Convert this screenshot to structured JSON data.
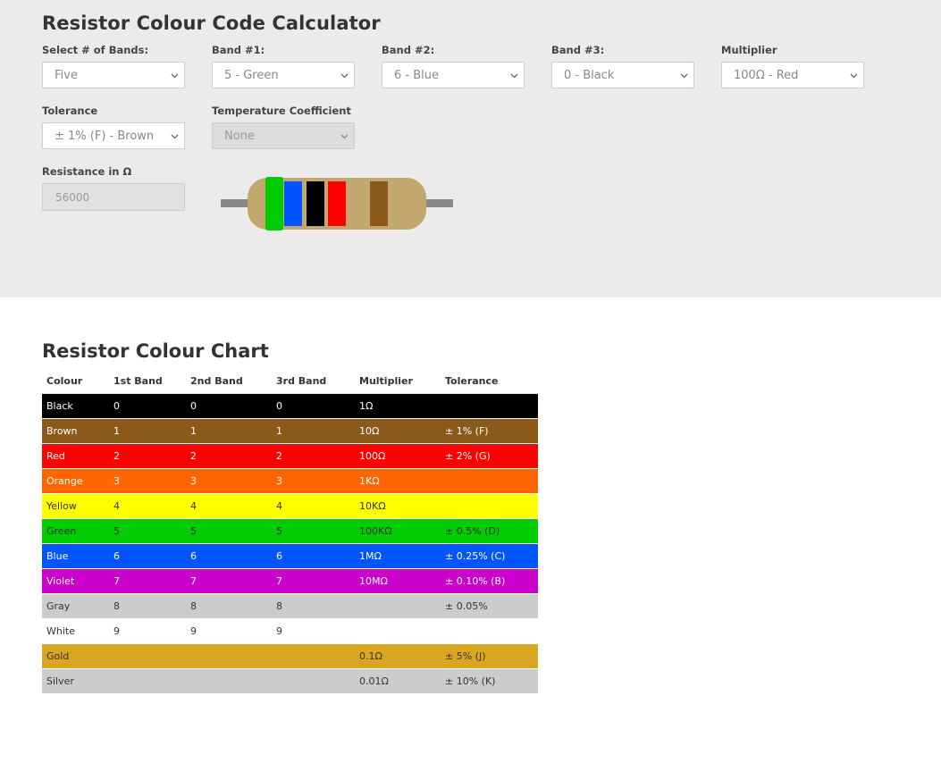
{
  "calculator": {
    "title": "Resistor Colour Code Calculator",
    "bands_label": "Select # of Bands:",
    "bands_value": "Five",
    "band1_label": "Band #1:",
    "band1_value": "5 - Green",
    "band2_label": "Band #2:",
    "band2_value": "6 - Blue",
    "band3_label": "Band #3:",
    "band3_value": "0 - Black",
    "multiplier_label": "Multiplier",
    "multiplier_value": "100Ω - Red",
    "tolerance_label": "Tolerance",
    "tolerance_value": "± 1% (F) - Brown",
    "tempco_label": "Temperature Coefficient",
    "tempco_value": "None",
    "resistance_label": "Resistance in Ω",
    "resistance_value": "56000"
  },
  "resistor_bands": [
    "#00cc00",
    "#0055ff",
    "#000000",
    "#ff0000",
    "#8b5a1a"
  ],
  "chart": {
    "title": "Resistor Colour Chart",
    "headers": [
      "Colour",
      "1st Band",
      "2nd Band",
      "3rd Band",
      "Multiplier",
      "Tolerance"
    ],
    "rows": [
      {
        "cells": [
          "Black",
          "0",
          "0",
          "0",
          "1Ω",
          ""
        ],
        "bg": "#000000",
        "fg": "#ffffff"
      },
      {
        "cells": [
          "Brown",
          "1",
          "1",
          "1",
          "10Ω",
          "± 1% (F)"
        ],
        "bg": "#8b5a1a",
        "fg": "#ffffff"
      },
      {
        "cells": [
          "Red",
          "2",
          "2",
          "2",
          "100Ω",
          "± 2% (G)"
        ],
        "bg": "#ff0000",
        "fg": "#ffffff"
      },
      {
        "cells": [
          "Orange",
          "3",
          "3",
          "3",
          "1KΩ",
          ""
        ],
        "bg": "#ff6600",
        "fg": "#ffffff"
      },
      {
        "cells": [
          "Yellow",
          "4",
          "4",
          "4",
          "10KΩ",
          ""
        ],
        "bg": "#ffff00",
        "fg": "#333333"
      },
      {
        "cells": [
          "Green",
          "5",
          "5",
          "5",
          "100KΩ",
          "± 0.5% (D)"
        ],
        "bg": "#00cc00",
        "fg": "#333333"
      },
      {
        "cells": [
          "Blue",
          "6",
          "6",
          "6",
          "1MΩ",
          "± 0.25% (C)"
        ],
        "bg": "#0055ff",
        "fg": "#ffffff"
      },
      {
        "cells": [
          "Violet",
          "7",
          "7",
          "7",
          "10MΩ",
          "± 0.10% (B)"
        ],
        "bg": "#cc00cc",
        "fg": "#ffffff"
      },
      {
        "cells": [
          "Gray",
          "8",
          "8",
          "8",
          "",
          "± 0.05%"
        ],
        "bg": "#cccccc",
        "fg": "#333333"
      },
      {
        "cells": [
          "White",
          "9",
          "9",
          "9",
          "",
          ""
        ],
        "bg": "#ffffff",
        "fg": "#333333"
      },
      {
        "cells": [
          "Gold",
          "",
          "",
          "",
          "0.1Ω",
          "± 5% (J)"
        ],
        "bg": "#daa520",
        "fg": "#333333"
      },
      {
        "cells": [
          "Silver",
          "",
          "",
          "",
          "0.01Ω",
          "± 10% (K)"
        ],
        "bg": "#cccccc",
        "fg": "#333333"
      }
    ]
  }
}
